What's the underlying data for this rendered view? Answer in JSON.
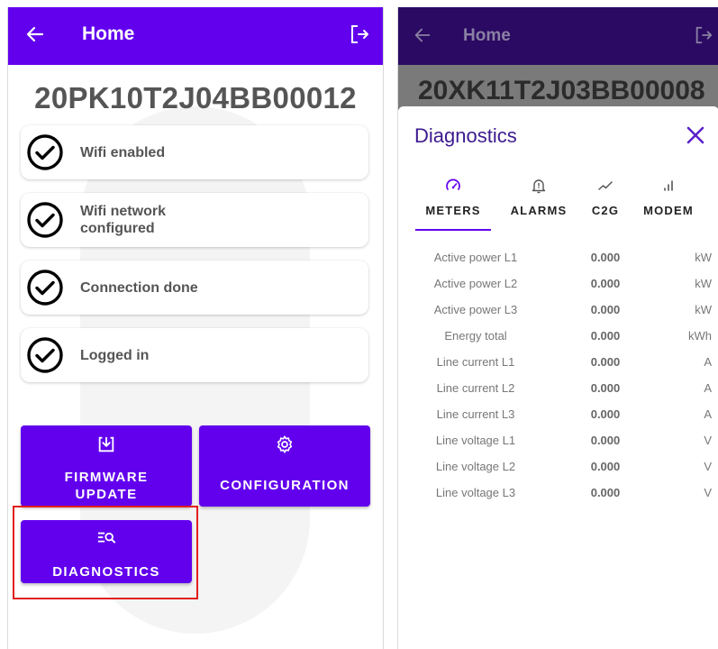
{
  "left_screen": {
    "appbar": {
      "title": "Home"
    },
    "serial": "20PK10T2J04BB00012",
    "status_items": [
      {
        "label": "Wifi enabled"
      },
      {
        "label": "Wifi network configured"
      },
      {
        "label": "Connection done"
      },
      {
        "label": "Logged in"
      }
    ],
    "buttons": {
      "firmware_update": "FIRMWARE UPDATE",
      "configuration": "CONFIGURATION",
      "diagnostics": "DIAGNOSTICS"
    }
  },
  "right_screen": {
    "appbar": {
      "title": "Home"
    },
    "serial": "20XK11T2J03BB00008",
    "dialog": {
      "title": "Diagnostics",
      "tabs": [
        {
          "label": "METERS",
          "icon": "speedometer-icon",
          "selected": true
        },
        {
          "label": "ALARMS",
          "icon": "bell-alert-icon",
          "selected": false
        },
        {
          "label": "C2G",
          "icon": "trend-line-icon",
          "selected": false
        },
        {
          "label": "MODEM",
          "icon": "signal-bars-icon",
          "selected": false
        }
      ],
      "meters": [
        {
          "name": "Active power L1",
          "value": "0.000",
          "unit": "kW"
        },
        {
          "name": "Active power L2",
          "value": "0.000",
          "unit": "kW"
        },
        {
          "name": "Active power L3",
          "value": "0.000",
          "unit": "kW"
        },
        {
          "name": "Energy total",
          "value": "0.000",
          "unit": "kWh"
        },
        {
          "name": "Line current L1",
          "value": "0.000",
          "unit": "A"
        },
        {
          "name": "Line current L2",
          "value": "0.000",
          "unit": "A"
        },
        {
          "name": "Line current L3",
          "value": "0.000",
          "unit": "A"
        },
        {
          "name": "Line voltage L1",
          "value": "0.000",
          "unit": "V"
        },
        {
          "name": "Line voltage L2",
          "value": "0.000",
          "unit": "V"
        },
        {
          "name": "Line voltage L3",
          "value": "0.000",
          "unit": "V"
        }
      ]
    }
  },
  "colors": {
    "primary": "#6200ee",
    "dim_appbar": "#2a0a63",
    "dialog_title": "#3d1a8f",
    "highlight": "#e11f1f"
  }
}
